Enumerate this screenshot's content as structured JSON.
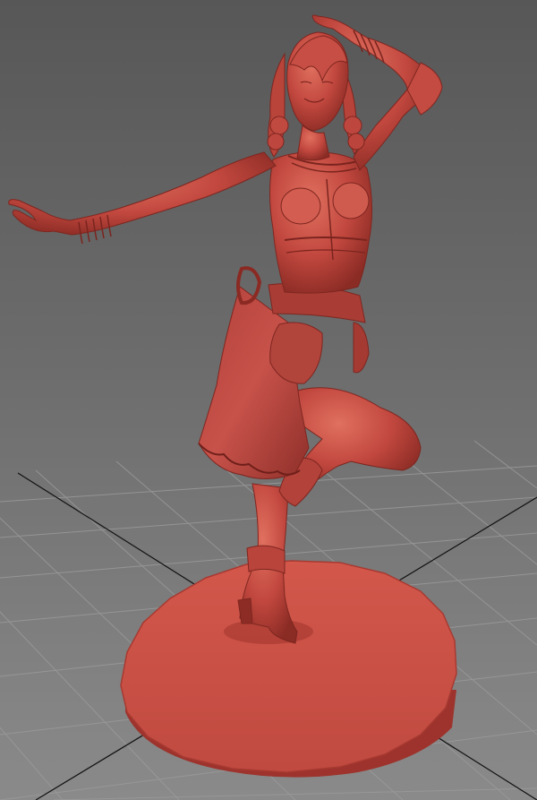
{
  "viewport": {
    "view": "perspective",
    "background_top": "#575757",
    "background_bottom": "#8a8a8a",
    "grid_color": "#9a9a9a",
    "axis_color": "#000000",
    "model_color": "#c2483f",
    "model_shadow": "#7a231d",
    "model_highlight": "#dd6a5e"
  },
  "scene": {
    "object": "figurine-model",
    "pose": "dancing",
    "base": "round-pedestal",
    "shading": "clay"
  }
}
